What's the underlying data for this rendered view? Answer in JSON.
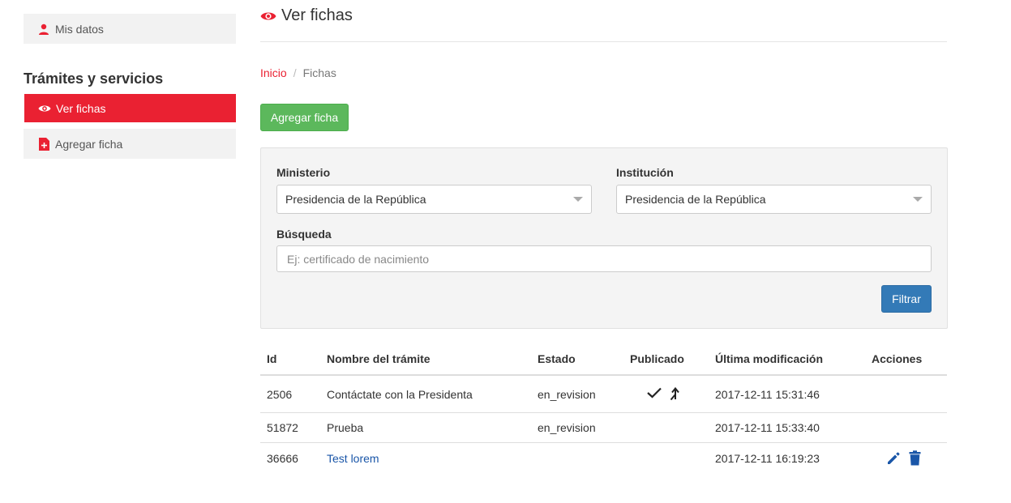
{
  "sidebar": {
    "my_data": {
      "label": "Mis datos",
      "icon": "user-icon"
    },
    "section_title": "Trámites y servicios",
    "items": [
      {
        "label": "Ver fichas",
        "icon": "eye-icon",
        "active": true
      },
      {
        "label": "Agregar ficha",
        "icon": "file-add-icon",
        "active": false
      }
    ]
  },
  "header": {
    "title": "Ver fichas",
    "icon": "eye-icon"
  },
  "breadcrumb": {
    "home": "Inicio",
    "separator": "/",
    "current": "Fichas"
  },
  "actions": {
    "add_label": "Agregar ficha"
  },
  "filters": {
    "ministry": {
      "label": "Ministerio",
      "value": "Presidencia de la República"
    },
    "institution": {
      "label": "Institución",
      "value": "Presidencia de la República"
    },
    "search": {
      "label": "Búsqueda",
      "placeholder": "Ej: certificado de nacimiento",
      "value": ""
    },
    "filter_label": "Filtrar"
  },
  "table": {
    "columns": [
      "Id",
      "Nombre del trámite",
      "Estado",
      "Publicado",
      "Última modificación",
      "Acciones"
    ],
    "rows": [
      {
        "id": "2506",
        "name": "Contáctate con la Presidenta",
        "status": "en_revision",
        "published_icons": [
          "check-icon",
          "merge-icon"
        ],
        "modified": "2017-12-11 15:31:46",
        "actions": []
      },
      {
        "id": "51872",
        "name": "Prueba",
        "status": "en_revision",
        "published_icons": [],
        "modified": "2017-12-11 15:33:40",
        "actions": []
      },
      {
        "id": "36666",
        "name": "Test lorem",
        "status": "",
        "published_icons": [],
        "modified": "2017-12-11 16:19:23",
        "actions": [
          "edit-icon",
          "trash-icon"
        ]
      }
    ]
  },
  "colors": {
    "accent": "#ea2132",
    "success": "#5cb85c",
    "primary": "#337ab7",
    "link": "#1a56a8"
  }
}
